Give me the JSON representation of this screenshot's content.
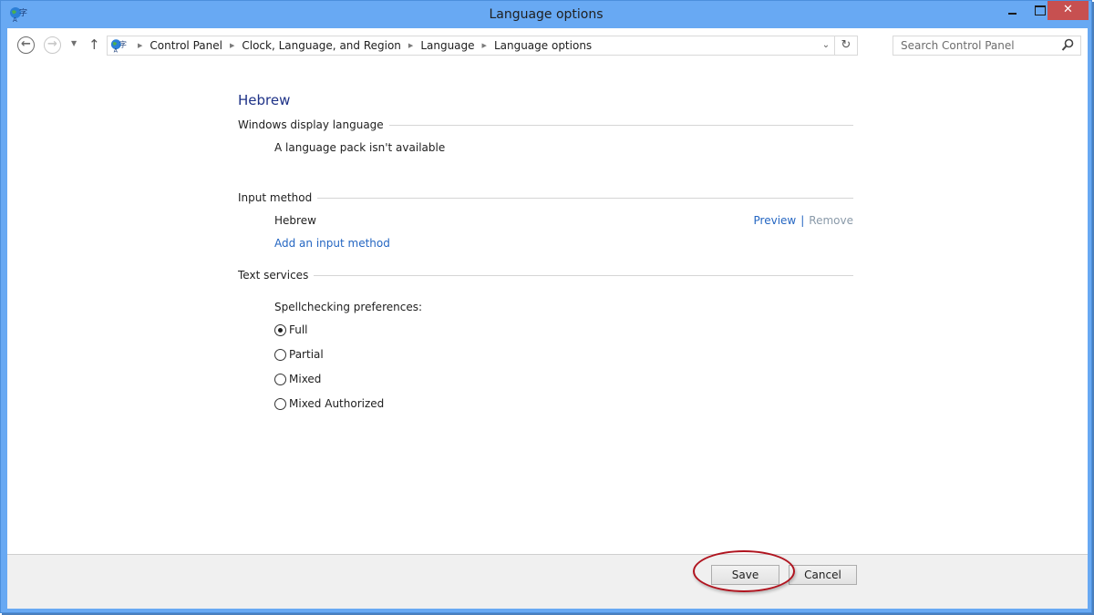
{
  "window": {
    "title": "Language options",
    "controls": {
      "minimize": "minimize",
      "maximize": "maximize",
      "close": "✕"
    }
  },
  "navbar": {
    "back_icon": "←",
    "forward_icon": "→",
    "recent_icon": "▼",
    "up_icon": "↑",
    "breadcrumbs": [
      "Control Panel",
      "Clock, Language, and Region",
      "Language",
      "Language options"
    ],
    "breadcrumb_separator": "▶",
    "dropdown_icon": "⌄",
    "refresh_icon": "↻",
    "search_placeholder": "Search Control Panel"
  },
  "content": {
    "language_name": "Hebrew",
    "sections": {
      "display_language": {
        "label": "Windows display language",
        "status": "A language pack isn't available"
      },
      "input_method": {
        "label": "Input method",
        "method_name": "Hebrew",
        "preview_link": "Preview",
        "separator": "|",
        "remove_link": "Remove",
        "add_link": "Add an input method"
      },
      "text_services": {
        "label": "Text services",
        "spellcheck_label": "Spellchecking preferences:",
        "options": [
          {
            "label": "Full",
            "checked": true
          },
          {
            "label": "Partial",
            "checked": false
          },
          {
            "label": "Mixed",
            "checked": false
          },
          {
            "label": "Mixed Authorized",
            "checked": false
          }
        ]
      }
    }
  },
  "footer": {
    "save_label": "Save",
    "cancel_label": "Cancel"
  },
  "colors": {
    "title_bar": "#68a9f3",
    "close_button": "#c75050",
    "heading": "#1e3287",
    "link": "#2466c2",
    "highlight_annotation": "#b0141f"
  }
}
